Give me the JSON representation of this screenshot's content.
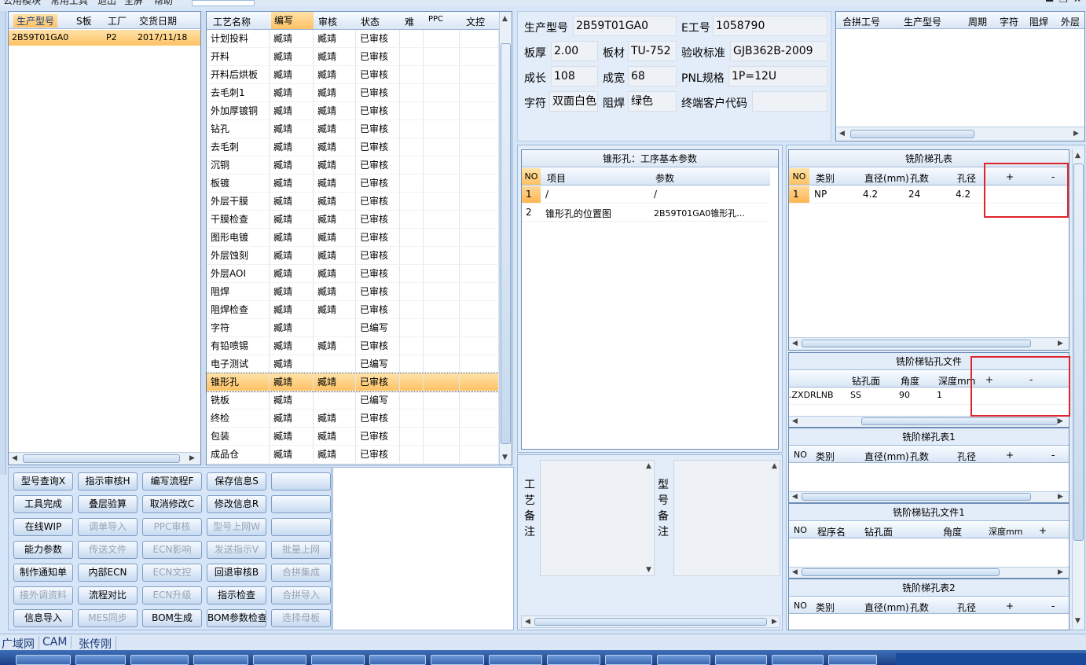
{
  "menu": {
    "items": [
      "公用模块",
      "常用工具",
      "退出",
      "全屏",
      "帮助"
    ]
  },
  "orders": {
    "columns": [
      "生产型号",
      "S板",
      "工厂",
      "交货日期"
    ],
    "rows": [
      [
        "2B59T01GA0",
        "",
        "P2",
        "2017/11/18"
      ]
    ]
  },
  "process": {
    "columns": [
      "工艺名称",
      "编写",
      "审核",
      "状态",
      "难",
      "PPC",
      "文控"
    ],
    "rows": [
      [
        "计划投料",
        "臧靖",
        "臧靖",
        "已审核"
      ],
      [
        "开料",
        "臧靖",
        "臧靖",
        "已审核"
      ],
      [
        "开料后烘板",
        "臧靖",
        "臧靖",
        "已审核"
      ],
      [
        "去毛刺1",
        "臧靖",
        "臧靖",
        "已审核"
      ],
      [
        "外加厚镀铜",
        "臧靖",
        "臧靖",
        "已审核"
      ],
      [
        "钻孔",
        "臧靖",
        "臧靖",
        "已审核"
      ],
      [
        "去毛刺",
        "臧靖",
        "臧靖",
        "已审核"
      ],
      [
        "沉铜",
        "臧靖",
        "臧靖",
        "已审核"
      ],
      [
        "板镀",
        "臧靖",
        "臧靖",
        "已审核"
      ],
      [
        "外层干膜",
        "臧靖",
        "臧靖",
        "已审核"
      ],
      [
        "干膜检查",
        "臧靖",
        "臧靖",
        "已审核"
      ],
      [
        "图形电镀",
        "臧靖",
        "臧靖",
        "已审核"
      ],
      [
        "外层蚀刻",
        "臧靖",
        "臧靖",
        "已审核"
      ],
      [
        "外层AOI",
        "臧靖",
        "臧靖",
        "已审核"
      ],
      [
        "阻焊",
        "臧靖",
        "臧靖",
        "已审核"
      ],
      [
        "阻焊检查",
        "臧靖",
        "臧靖",
        "已审核"
      ],
      [
        "字符",
        "臧靖",
        "",
        "已编写"
      ],
      [
        "有铅喷锡",
        "臧靖",
        "臧靖",
        "已审核"
      ],
      [
        "电子测试",
        "臧靖",
        "",
        "已编写"
      ],
      [
        "锥形孔",
        "臧靖",
        "臧靖",
        "已审核"
      ],
      [
        "铣板",
        "臧靖",
        "",
        "已编写"
      ],
      [
        "终检",
        "臧靖",
        "臧靖",
        "已审核"
      ],
      [
        "包装",
        "臧靖",
        "臧靖",
        "已审核"
      ],
      [
        "成品仓",
        "臧靖",
        "臧靖",
        "已审核"
      ]
    ],
    "selected_row": 19
  },
  "buttons": [
    [
      "型号查询X",
      "指示审核H",
      "编写流程F",
      "保存信息S",
      ""
    ],
    [
      "工具完成",
      "叠层验算",
      "取消修改C",
      "修改信息R",
      ""
    ],
    [
      "在线WIP",
      "调单导入",
      "PPC审核",
      "型号上网W",
      ""
    ],
    [
      "能力参数",
      "传送文件",
      "ECN影响",
      "发送指示V",
      "批量上网"
    ],
    [
      "制作通知单",
      "内部ECN",
      "ECN文控",
      "回退审核B",
      "合拼集成"
    ],
    [
      "接外调资料",
      "流程对比",
      "ECN升级",
      "指示检查",
      "合拼导入"
    ],
    [
      "信息导入",
      "MES同步",
      "BOM生成",
      "BOM参数检查",
      "选择母板"
    ]
  ],
  "buttons_disabled": [
    [
      false,
      false,
      false,
      false,
      false
    ],
    [
      false,
      false,
      false,
      false,
      false
    ],
    [
      false,
      true,
      true,
      true,
      false
    ],
    [
      false,
      true,
      true,
      true,
      true
    ],
    [
      false,
      false,
      true,
      false,
      true
    ],
    [
      true,
      false,
      true,
      false,
      true
    ],
    [
      false,
      true,
      false,
      false,
      true
    ]
  ],
  "info": {
    "model_label": "生产型号",
    "model": "2B59T01GA0",
    "e_label": "E工号",
    "e_no": "1058790",
    "thick_label": "板厚",
    "thick": "2.00",
    "material_label": "板材",
    "material": "TU-752",
    "std_label": "验收标准",
    "std": "GJB362B-2009",
    "len_label": "成长",
    "len": "108",
    "wid_label": "成宽",
    "wid": "68",
    "pnl_label": "PNL规格",
    "pnl": "1P=12U",
    "char_label": "字符",
    "char": "双面白色",
    "mask_label": "阻焊",
    "mask": "绿色",
    "cust_label": "终端客户代码",
    "cust": ""
  },
  "merge": {
    "columns": [
      "合拼工号",
      "生产型号",
      "周期",
      "字符",
      "阻焊",
      "外层"
    ]
  },
  "cone": {
    "title": "锥形孔：工序基本参数",
    "columns": [
      "NO",
      "项目",
      "参数"
    ],
    "rows": [
      [
        "1",
        "/",
        "/"
      ],
      [
        "2",
        "锥形孔的位置图",
        "2B59T01GA0锥形孔..."
      ]
    ]
  },
  "remarks": {
    "process_label": "工艺备注",
    "model_label": "型号备注"
  },
  "step1": {
    "title": "铣阶梯孔表",
    "columns": [
      "NO",
      "类别",
      "直径(mm)",
      "孔数",
      "孔径",
      "+",
      "-"
    ],
    "rows": [
      [
        "1",
        "NP",
        "4.2",
        "24",
        "4.2"
      ]
    ]
  },
  "step_drill": {
    "title": "铣阶梯钻孔文件",
    "columns": [
      "",
      "钻孔面",
      "角度",
      "深度mm",
      "+",
      "-"
    ],
    "rows": [
      [
        ".ZXDRLNB",
        "SS",
        "90",
        "1"
      ]
    ]
  },
  "step2": {
    "title": "铣阶梯孔表1",
    "columns": [
      "NO",
      "类别",
      "直径(mm)",
      "孔数",
      "孔径",
      "+",
      "-"
    ]
  },
  "step_drill2": {
    "title": "铣阶梯钻孔文件1",
    "columns": [
      "NO",
      "程序名",
      "钻孔面",
      "角度",
      "深度mm",
      "+"
    ]
  },
  "step3": {
    "title": "铣阶梯孔表2",
    "columns": [
      "NO",
      "类别",
      "直径(mm)",
      "孔数",
      "孔径",
      "+",
      "-"
    ]
  },
  "status": {
    "items": [
      "广域网",
      "CAM",
      "张传刚"
    ]
  },
  "colors": {
    "accent": "#fdb652",
    "highlight": "#e0242a",
    "border": "#6d8db5"
  }
}
